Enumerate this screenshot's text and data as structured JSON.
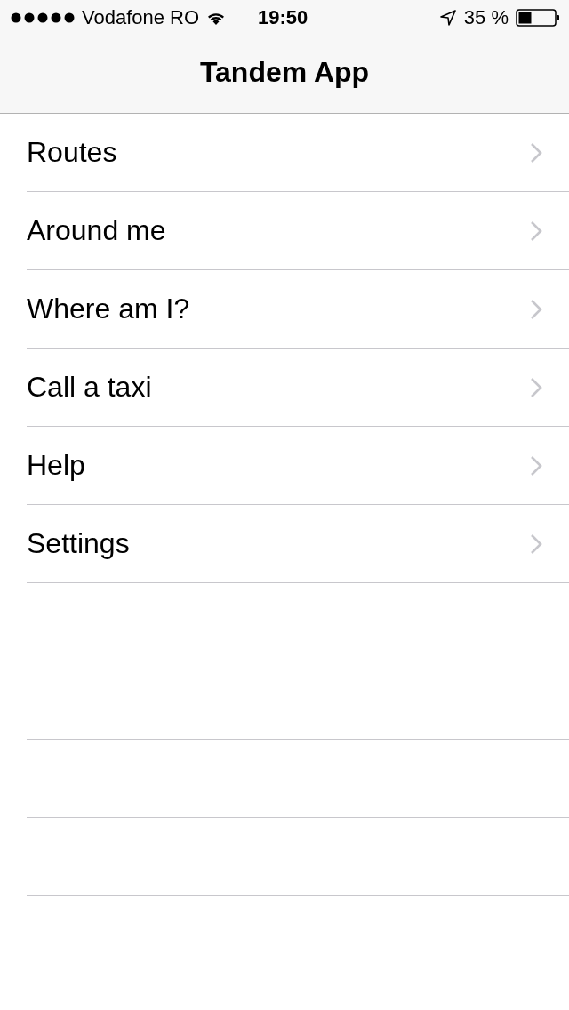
{
  "status_bar": {
    "carrier": "Vodafone RO",
    "time": "19:50",
    "battery": "35 %"
  },
  "nav_bar": {
    "title": "Tandem App"
  },
  "menu": [
    {
      "label": "Routes"
    },
    {
      "label": "Around me"
    },
    {
      "label": "Where am I?"
    },
    {
      "label": "Call a taxi"
    },
    {
      "label": "Help"
    },
    {
      "label": "Settings"
    }
  ]
}
